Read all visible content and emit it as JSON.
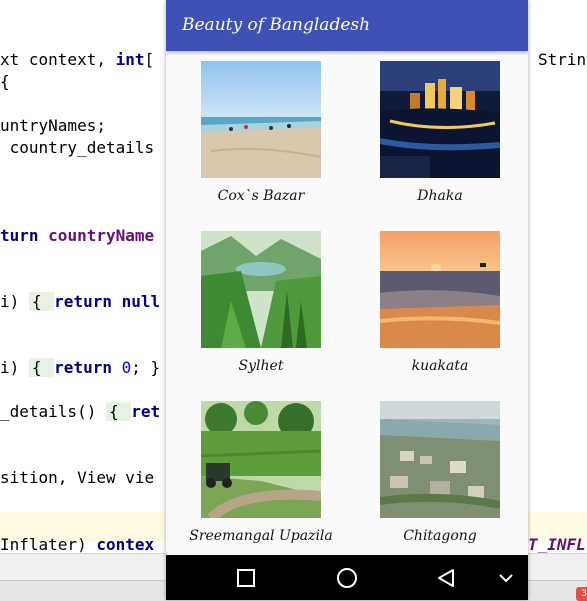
{
  "ide": {
    "code_lines": [
      {
        "parts": [
          {
            "t": "xt context, ",
            "c": ""
          },
          {
            "t": "int",
            "c": "kw"
          },
          {
            "t": "[",
            "c": ""
          }
        ]
      },
      {
        "parts": [
          {
            "t": "{",
            "c": ""
          }
        ]
      },
      {
        "parts": [
          {
            "t": "untryNames;",
            "c": ""
          }
        ]
      },
      {
        "parts": [
          {
            "t": " country_details",
            "c": ""
          }
        ]
      },
      {
        "parts": [
          {
            "t": "turn ",
            "c": "kw"
          },
          {
            "t": "countryName",
            "c": "fld"
          }
        ]
      },
      {
        "parts": [
          {
            "t": "i) ",
            "c": ""
          },
          {
            "t": "{ ",
            "c": "fold"
          },
          {
            "t": "return null",
            "c": "kw"
          }
        ]
      },
      {
        "parts": [
          {
            "t": "i) ",
            "c": ""
          },
          {
            "t": "{ ",
            "c": "fold"
          },
          {
            "t": "return ",
            "c": "kw"
          },
          {
            "t": "0",
            "c": "num"
          },
          {
            "t": "; }",
            "c": ""
          }
        ]
      },
      {
        "parts": [
          {
            "t": "_details() ",
            "c": ""
          },
          {
            "t": "{ ",
            "c": "fold"
          },
          {
            "t": "ret",
            "c": "kw"
          }
        ]
      },
      {
        "parts": [
          {
            "t": "sition, View vie",
            "c": ""
          }
        ]
      },
      {
        "parts": [
          {
            "t": "Inflater) ",
            "c": ""
          },
          {
            "t": "contex",
            "c": "kw"
          }
        ]
      }
    ],
    "right_fragment_1": "String",
    "right_fragment_2": "T_INFL",
    "badge": "3"
  },
  "app": {
    "title": "Beauty of Bangladesh",
    "places": [
      {
        "name": "Cox`s Bazar",
        "scene": "beach"
      },
      {
        "name": "Dhaka",
        "scene": "night-city"
      },
      {
        "name": "Sylhet",
        "scene": "green-hills"
      },
      {
        "name": "kuakata",
        "scene": "sunset-sea"
      },
      {
        "name": "Sreemangal Upazila",
        "scene": "tea-garden"
      },
      {
        "name": "Chitagong",
        "scene": "port-city"
      }
    ]
  },
  "navbar": {
    "icons": [
      "recents-icon",
      "home-icon",
      "back-icon",
      "chevron-down-icon"
    ]
  }
}
